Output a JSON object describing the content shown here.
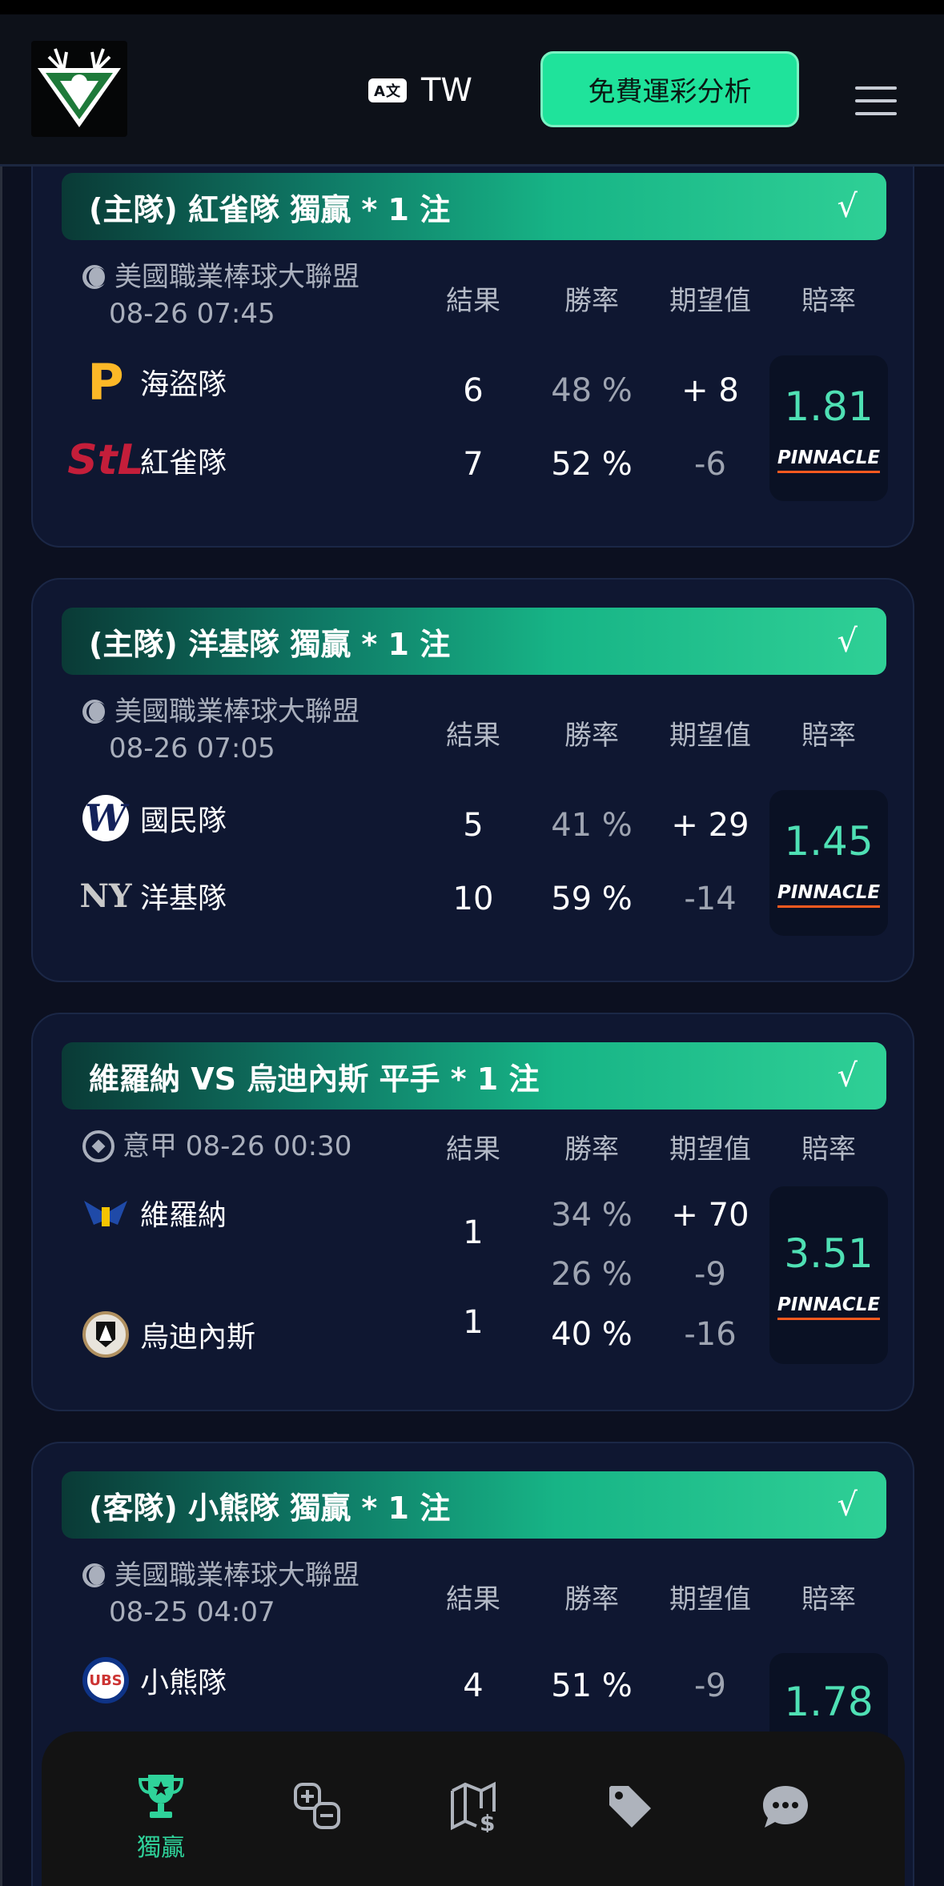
{
  "header": {
    "lang_icon_text": "A文",
    "lang": "TW",
    "cta": "免費運彩分析"
  },
  "columns": {
    "result": "結果",
    "rate": "勝率",
    "ev": "期望值",
    "odds": "賠率"
  },
  "cards": [
    {
      "banner": "(主隊) 紅雀隊 獨贏 * 1 注",
      "check": "√",
      "league": "美國職業棒球大聯盟",
      "date": "08-26 07:45",
      "teams": [
        {
          "name": "海盜隊",
          "result": "6",
          "rate": "48 %",
          "ev": "+ 8"
        },
        {
          "name": "紅雀隊",
          "result": "7",
          "rate": "52 %",
          "ev": "-6"
        }
      ],
      "odds": "1.81",
      "bookmaker": "PINNACLE"
    },
    {
      "banner": "(主隊) 洋基隊 獨贏 * 1 注",
      "check": "√",
      "league": "美國職業棒球大聯盟",
      "date": "08-26 07:05",
      "teams": [
        {
          "name": "國民隊",
          "result": "5",
          "rate": "41 %",
          "ev": "+ 29"
        },
        {
          "name": "洋基隊",
          "result": "10",
          "rate": "59 %",
          "ev": "-14"
        }
      ],
      "odds": "1.45",
      "bookmaker": "PINNACLE"
    },
    {
      "banner": "維羅納 VS 烏迪內斯 平手 * 1 注",
      "check": "√",
      "league": "意甲 08-26 00:30",
      "teams": [
        {
          "name": "維羅納",
          "result": "1",
          "rate": "34 %",
          "ev": "+ 70"
        },
        {
          "name": "烏迪內斯",
          "result": "1",
          "rate": "40 %",
          "ev": "-16"
        }
      ],
      "draw": {
        "rate": "26 %",
        "ev": "-9"
      },
      "odds": "3.51",
      "bookmaker": "PINNACLE"
    },
    {
      "banner": "(客隊) 小熊隊 獨贏 * 1 注",
      "check": "√",
      "league": "美國職業棒球大聯盟",
      "date": "08-25 04:07",
      "teams": [
        {
          "name": "小熊隊",
          "result": "4",
          "rate": "51 %",
          "ev": "-9"
        }
      ],
      "odds": "1.78"
    }
  ],
  "nav": {
    "active_label": "獨贏",
    "items": [
      "trophy-icon",
      "plus-minus-icon",
      "map-dollar-icon",
      "tag-icon",
      "chat-icon"
    ]
  },
  "colors": {
    "accent": "#1fe39b",
    "odds": "#4fe0b4",
    "card": "#0f1731",
    "background": "#0c1020"
  }
}
